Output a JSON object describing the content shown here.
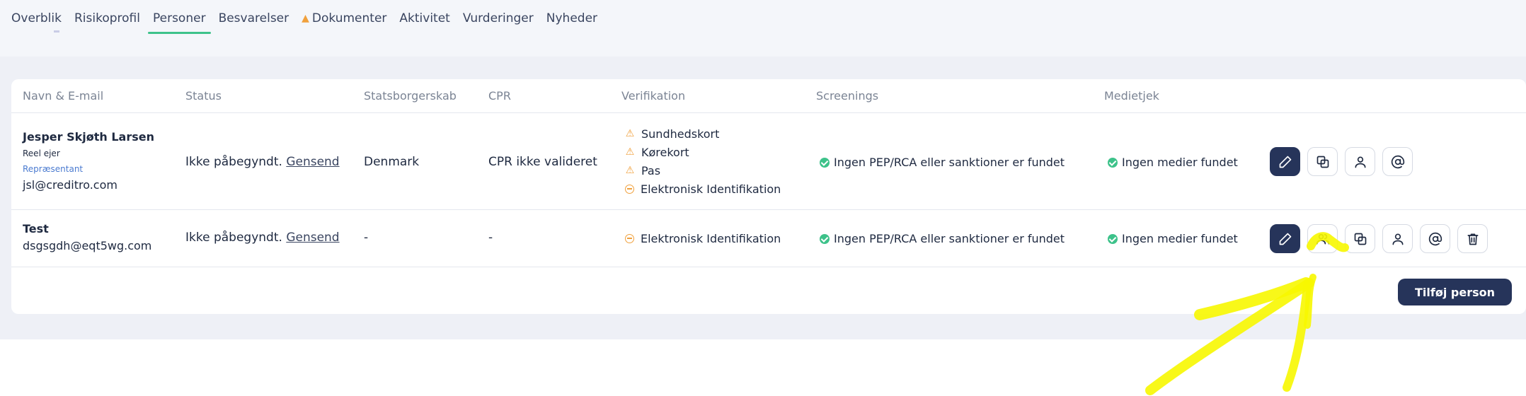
{
  "tabs": [
    {
      "label": "Overblik",
      "active": false
    },
    {
      "label": "Risikoprofil",
      "active": false
    },
    {
      "label": "Personer",
      "active": true
    },
    {
      "label": "Besvarelser",
      "active": false
    },
    {
      "label": "Dokumenter",
      "active": false,
      "warning_icon": "warning-icon"
    },
    {
      "label": "Aktivitet",
      "active": false
    },
    {
      "label": "Vurderinger",
      "active": false
    },
    {
      "label": "Nyheder",
      "active": false
    }
  ],
  "table": {
    "headers": [
      "Navn & E-mail",
      "Status",
      "Statsborgerskab",
      "CPR",
      "Verifikation",
      "Screenings",
      "Medietjek"
    ],
    "rows": [
      {
        "name": "Jesper Skjøth Larsen",
        "role": "Reel ejer",
        "representative": "Repræsentant",
        "email": "jsl@creditro.com",
        "status": "Ikke påbegyndt.",
        "resend": "Gensend",
        "citizenship": "Denmark",
        "cpr": "CPR ikke valideret",
        "verification": [
          {
            "label": "Sundhedskort",
            "icon": "warning-icon"
          },
          {
            "label": "Kørekort",
            "icon": "warning-icon"
          },
          {
            "label": "Pas",
            "icon": "warning-icon"
          },
          {
            "label": "Elektronisk Identifikation",
            "icon": "minus-circle-icon"
          }
        ],
        "screening": "Ingen PEP/RCA eller sanktioner er fundet",
        "media": "Ingen medier fundet",
        "actions": [
          "edit-icon",
          "copy-icon",
          "user-icon",
          "at-icon"
        ]
      },
      {
        "name": "Test",
        "email": "dsgsgdh@eqt5wg.com",
        "status": "Ikke påbegyndt.",
        "resend": "Gensend",
        "citizenship": "-",
        "cpr": "-",
        "verification": [
          {
            "label": "Elektronisk Identifikation",
            "icon": "minus-circle-icon"
          }
        ],
        "screening": "Ingen PEP/RCA eller sanktioner er fundet",
        "media": "Ingen medier fundet",
        "actions": [
          "edit-icon",
          "users-icon",
          "copy-icon",
          "user-icon",
          "at-icon",
          "trash-icon"
        ]
      }
    ]
  },
  "add_person_label": "Tilføj person",
  "colors": {
    "accent_green": "#3dc28a",
    "primary_navy": "#26345a",
    "warning_orange": "#f0a03c",
    "annotation_yellow": "#f7f700"
  }
}
